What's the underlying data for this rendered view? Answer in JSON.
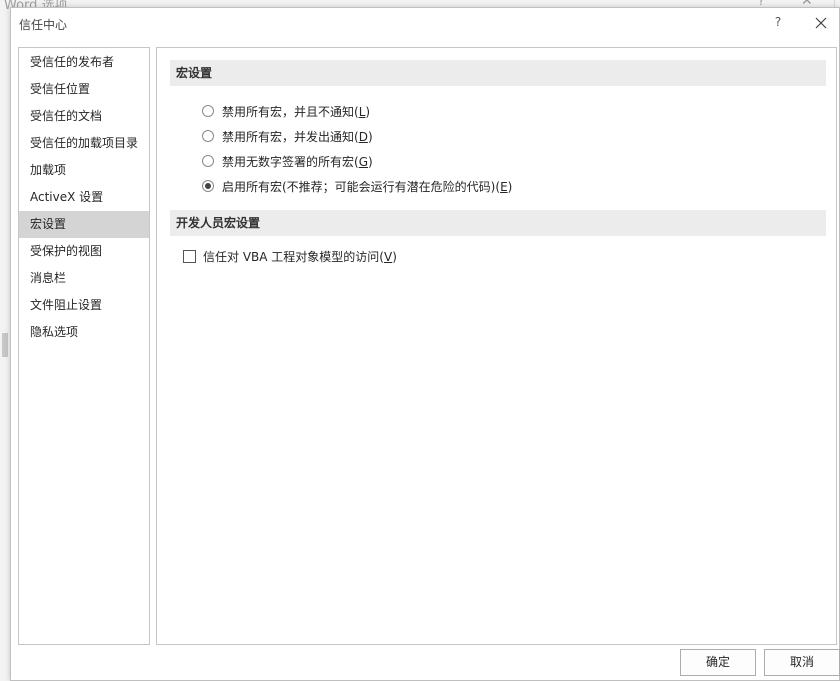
{
  "background_window": {
    "title": "Word 选项",
    "help_label": "?",
    "close_label": "✕"
  },
  "dialog": {
    "title": "信任中心",
    "help_label": "?"
  },
  "nav": {
    "items": [
      {
        "label": "受信任的发布者",
        "selected": false
      },
      {
        "label": "受信任位置",
        "selected": false
      },
      {
        "label": "受信任的文档",
        "selected": false
      },
      {
        "label": "受信任的加载项目录",
        "selected": false
      },
      {
        "label": "加载项",
        "selected": false
      },
      {
        "label": "ActiveX 设置",
        "selected": false
      },
      {
        "label": "宏设置",
        "selected": true
      },
      {
        "label": "受保护的视图",
        "selected": false
      },
      {
        "label": "消息栏",
        "selected": false
      },
      {
        "label": "文件阻止设置",
        "selected": false
      },
      {
        "label": "隐私选项",
        "selected": false
      }
    ]
  },
  "macro_settings": {
    "header": "宏设置",
    "options": [
      {
        "text": "禁用所有宏，并且不通知(",
        "key": "L",
        "tail": ")",
        "checked": false
      },
      {
        "text": "禁用所有宏，并发出通知(",
        "key": "D",
        "tail": ")",
        "checked": false
      },
      {
        "text": "禁用无数字签署的所有宏(",
        "key": "G",
        "tail": ")",
        "checked": false
      },
      {
        "text": "启用所有宏(不推荐；可能会运行有潜在危险的代码)(",
        "key": "E",
        "tail": ")",
        "checked": true
      }
    ]
  },
  "developer_settings": {
    "header": "开发人员宏设置",
    "vba_access": {
      "text": "信任对 VBA 工程对象模型的访问(",
      "key": "V",
      "tail": ")",
      "checked": false
    }
  },
  "buttons": {
    "ok": "确定",
    "cancel": "取消"
  }
}
